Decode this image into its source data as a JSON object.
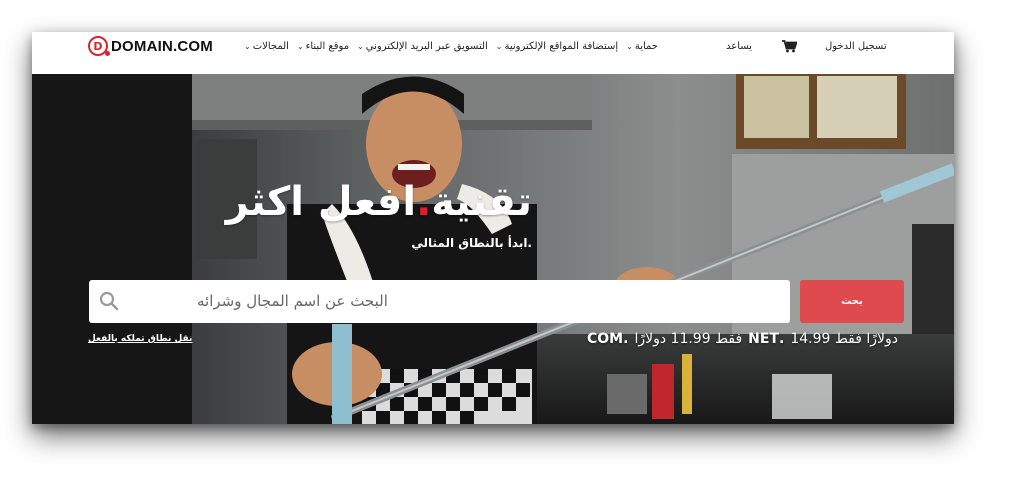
{
  "brand": {
    "logo_letter": "D",
    "logo_text": "DOMAIN.COM",
    "accent_color": "#d7262e"
  },
  "nav": {
    "items": [
      {
        "label": "المجالات"
      },
      {
        "label": "موقع البناء"
      },
      {
        "label": "التسويق عبر البريد الإلكتروني"
      },
      {
        "label": "إستضافة المواقع الإلكترونية"
      },
      {
        "label": "حماية"
      }
    ],
    "help_label": "يساعد",
    "cart_icon": "cart-icon",
    "signin_label": "تسجيل الدخول"
  },
  "hero": {
    "headline_part1": "تقنية",
    "headline_dot": ".",
    "headline_part2": "افعل اكثر",
    "subline": ".ابدأ بالنطاق المثالي"
  },
  "search": {
    "placeholder": "البحث عن اسم المجال وشرائه",
    "value": "",
    "button_label": "بحث",
    "button_color": "#df4a4f",
    "search_icon": "search-icon"
  },
  "transfer_link": "نقل نطاق تملكه بالفعل",
  "promo": {
    "com_tld": ".COM",
    "com_price_text": "فقط 11.99 دولارًا",
    "net_tld": ".NET",
    "net_price_text": "دولارًا فقط 14.99"
  }
}
